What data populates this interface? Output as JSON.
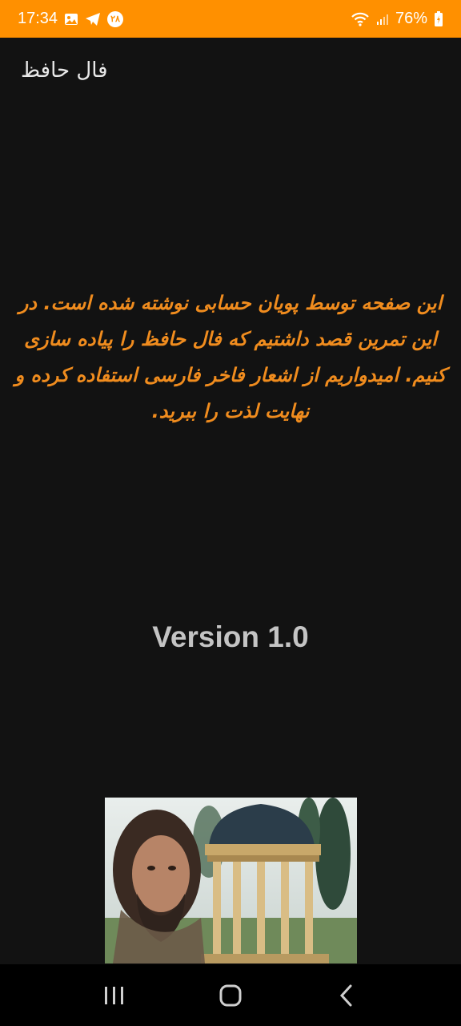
{
  "status_bar": {
    "time": "17:34",
    "notification_badge": "۲۸",
    "battery_percent": "76%",
    "icons": [
      "image-icon",
      "telegram-icon",
      "badge-icon",
      "wifi-icon",
      "signal-icon",
      "battery-icon"
    ]
  },
  "app_bar": {
    "title": "فال حافظ"
  },
  "main": {
    "about_text": "این صفحه توسط پویان حسابی نوشته شده است. در این تمرین قصد داشتیم که فال حافظ را پیاده سازی کنیم. امیدواریم از اشعار فاخر فارسی استفاده کرده و نهایت لذت را ببرید.",
    "version": "Version 1.0"
  },
  "nav_bar": {
    "icons": [
      "recents-icon",
      "home-icon",
      "back-icon"
    ]
  },
  "colors": {
    "status_bar": "#ff9000",
    "background": "#121212",
    "about_text": "#f08c1e",
    "version_text": "#c4c4c4"
  }
}
